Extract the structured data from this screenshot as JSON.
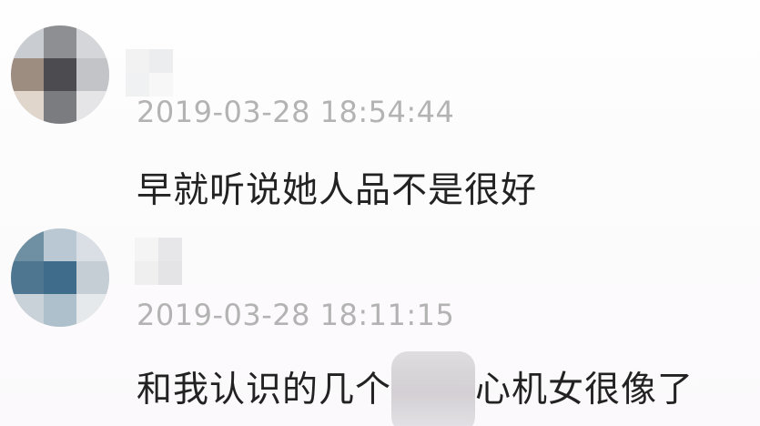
{
  "comments": [
    {
      "timestamp": "2019-03-28 18:54:44",
      "text": "早就听说她人品不是很好"
    },
    {
      "timestamp": "2019-03-28 18:11:15",
      "text_before": "和我认识的几个",
      "text_after": "心机女很像了"
    }
  ],
  "colors": {
    "timestamp": "#b3b3b3",
    "text": "#222222",
    "background": "#fdfcfd"
  }
}
